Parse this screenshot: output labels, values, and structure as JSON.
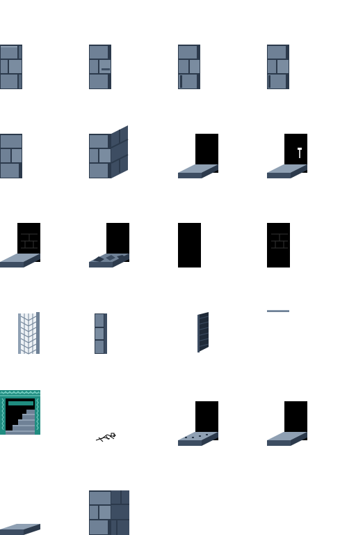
{
  "palette": {
    "background": "#ffffff",
    "stone": "#6f8196",
    "stone_dark": "#2c3a4c",
    "stone_light": "#8fa0b3",
    "wall_side": "#3d4d62",
    "void": "#000000",
    "lattice": "#1f8c80"
  }
}
